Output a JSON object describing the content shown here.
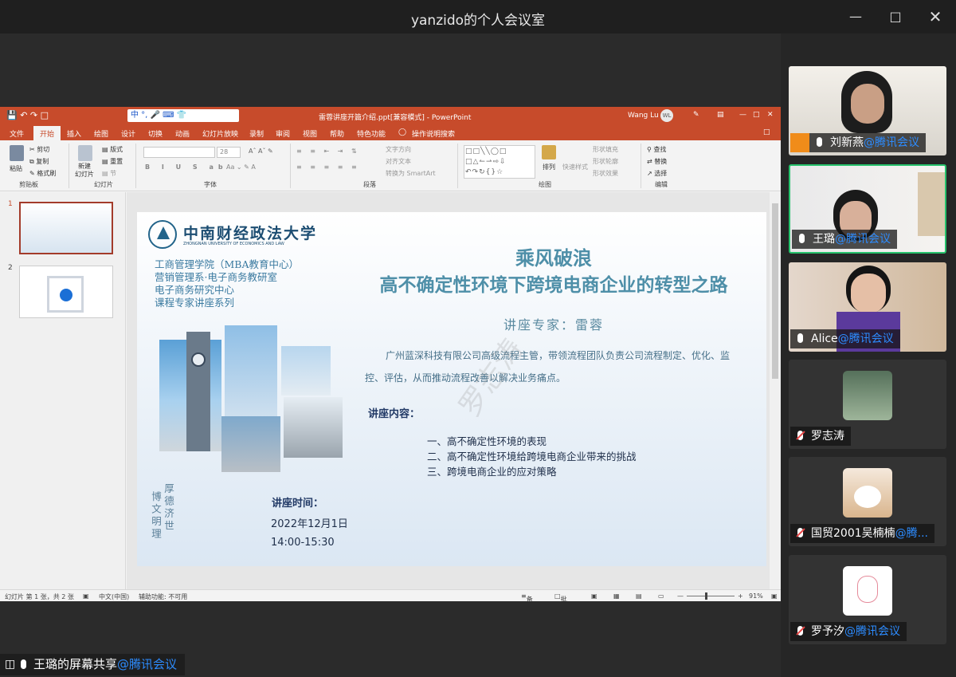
{
  "window": {
    "title": "yanzido的个人会议室"
  },
  "ppt": {
    "doc_title": "雷蓉讲座开篇介绍.ppt[兼容模式]",
    "app_name": "PowerPoint",
    "user": "Wang Lu",
    "user_initials": "WL",
    "ime": "中 °, 🎤 ⌨ 👕",
    "tabs": [
      "文件",
      "开始",
      "插入",
      "绘图",
      "设计",
      "切换",
      "动画",
      "幻灯片放映",
      "录制",
      "审阅",
      "视图",
      "帮助",
      "特色功能",
      "操作说明搜索"
    ],
    "ribbon": {
      "clipboard": {
        "paste": "粘贴",
        "cut": "剪切",
        "copy": "复制",
        "format": "格式刷",
        "label": "剪贴板"
      },
      "slides": {
        "new_slide": "新建\n幻灯片",
        "layout": "版式",
        "reset": "重置",
        "section": "节",
        "label": "幻灯片"
      },
      "font": {
        "size": "28",
        "label": "字体"
      },
      "paragraph": {
        "text_dir": "文字方向",
        "align_text": "对齐文本",
        "smartart": "转换为 SmartArt",
        "label": "段落"
      },
      "drawing": {
        "arrange": "排列",
        "quick_styles": "快速样式",
        "fill": "形状填充",
        "outline": "形状轮廓",
        "effects": "形状效果",
        "label": "绘图"
      },
      "editing": {
        "find": "查找",
        "replace": "替换",
        "select": "选择",
        "label": "编辑"
      }
    },
    "status": {
      "slide_info": "幻灯片 第 1 张，共 2 张",
      "language": "中文(中国)",
      "accessibility": "辅助功能: 不可用",
      "notes": "备注",
      "comments": "批注",
      "zoom": "91%"
    },
    "thumbs": [
      "1",
      "2"
    ]
  },
  "slide": {
    "university_cn": "中南财经政法大学",
    "university_en": "ZHONGNAN UNIVERSITY OF ECONOMICS AND LAW",
    "dept_lines": [
      "工商管理学院（MBA教育中心）",
      "营销管理系·电子商务教研室",
      "电子商务研究中心",
      "课程专家讲座系列"
    ],
    "title_line1": "乘风破浪",
    "title_line2": "高不确定性环境下跨境电商企业的转型之路",
    "expert": "讲座专家：雷蓉",
    "intro": "广州蓝深科技有限公司高级流程主管，带领流程团队负责公司流程制定、优化、监控、评估，从而推动流程改善以解决业务痛点。",
    "content_heading": "讲座内容：",
    "content_items": [
      "一、高不确定性环境的表现",
      "二、高不确定性环境给跨境电商企业带来的挑战",
      "三、跨境电商企业的应对策略"
    ],
    "time_heading": "讲座时间：",
    "date": "2022年12月1日",
    "hours": "14:00-15:30",
    "motto_right": "博文明理",
    "motto_left": "厚德济世",
    "watermark": "罗志涛"
  },
  "participants": [
    {
      "name": "刘新燕",
      "tag": "@腾讯会议",
      "muted": false,
      "host": true
    },
    {
      "name": "王璐",
      "tag": "@腾讯会议",
      "muted": false,
      "host": false
    },
    {
      "name": "Alice",
      "tag": "@腾讯会议",
      "muted": false,
      "host": false
    },
    {
      "name": "罗志涛",
      "tag": "",
      "muted": true,
      "host": false
    },
    {
      "name": "国贸2001吴楠楠",
      "tag": "@腾...",
      "muted": true,
      "host": false
    },
    {
      "name": "罗予汐",
      "tag": "@腾讯会议",
      "muted": true,
      "host": false
    }
  ],
  "share": {
    "name": "王璐的屏幕共享",
    "tag": "@腾讯会议"
  },
  "colors": {
    "ppt_accent": "#c74b2b",
    "speaker_border": "#26c26c",
    "tencent_blue": "#2d8cff"
  }
}
